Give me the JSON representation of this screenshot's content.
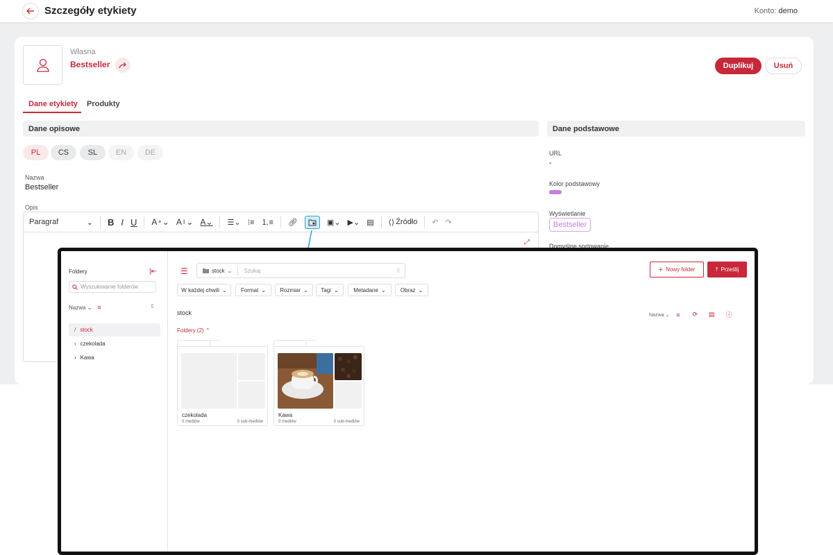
{
  "header": {
    "title": "Szczegóły etykiety",
    "account_label": "Konto:",
    "account_name": "demo"
  },
  "label": {
    "type": "Własna",
    "name": "Bestseller"
  },
  "actions": {
    "duplicate": "Duplikuj",
    "delete": "Usuń"
  },
  "tabs": [
    {
      "label": "Dane etykiety",
      "active": true
    },
    {
      "label": "Produkty",
      "active": false
    }
  ],
  "sections": {
    "descriptive": "Dane opisowe",
    "basic": "Dane podstawowe"
  },
  "languages": [
    {
      "code": "PL",
      "state": "active"
    },
    {
      "code": "CS",
      "state": "normal"
    },
    {
      "code": "SL",
      "state": "normal"
    },
    {
      "code": "EN",
      "state": "disabled"
    },
    {
      "code": "DE",
      "state": "disabled"
    }
  ],
  "fields": {
    "name_label": "Nazwa",
    "name_value": "Bestseller",
    "description_label": "Opis"
  },
  "editor": {
    "paragraph": "Paragraf",
    "source": "Źródło"
  },
  "basic": {
    "url_label": "URL",
    "url_value": "-",
    "color_label": "Kolor podstawowy",
    "color_value": "#c77de8",
    "display_label": "Wyświetlanie",
    "display_value": "Bestseller",
    "sort_label": "Domyślne sortowanie"
  },
  "media_picker": {
    "sidebar_title": "Foldery",
    "search_placeholder": "Wyszukiwanie folderów",
    "sort_label": "Nazwa",
    "tree": [
      {
        "label": "stock",
        "active": true
      },
      {
        "label": "czekolada",
        "active": false
      },
      {
        "label": "Kawa",
        "active": false
      }
    ],
    "path_folder": "stock",
    "search_input_placeholder": "Szukaj",
    "new_folder": "Nowy folder",
    "upload": "Prześlij",
    "filters": [
      "W każdej chwili",
      "Format",
      "Rozmiar",
      "Tagi",
      "Metadane",
      "Obraz"
    ],
    "current_folder": "stock",
    "sort_right": "Nazwa",
    "folders_count": "Foldery (2)",
    "folders": [
      {
        "name": "czekolada",
        "media": "0 mediów",
        "sub_media": "0 sub-mediów"
      },
      {
        "name": "Kawa",
        "media": "0 mediów",
        "sub_media": "0 sub-mediów"
      }
    ]
  }
}
